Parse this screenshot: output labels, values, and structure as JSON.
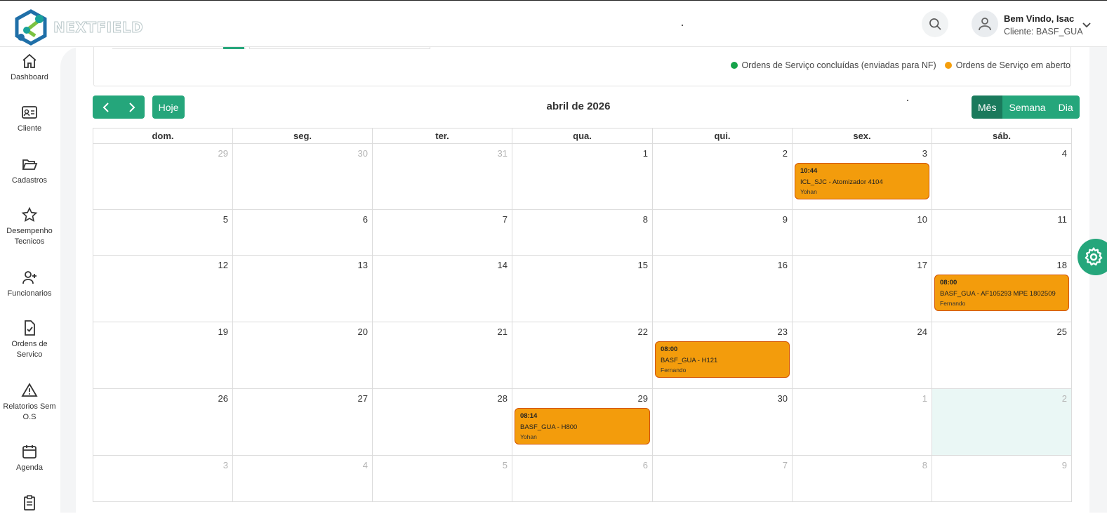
{
  "brand": {
    "name": "NEXTFIELD"
  },
  "user": {
    "welcome": "Bem Vindo, Isac",
    "client": "Cliente: BASF_GUA"
  },
  "sidebar": {
    "items": [
      {
        "label": "Dashboard",
        "icon": "home-icon"
      },
      {
        "label": "Cliente",
        "icon": "id-card-icon"
      },
      {
        "label": "Cadastros",
        "icon": "folder-open-icon"
      },
      {
        "label": "Desempenho Tecnicos",
        "icon": "star-icon"
      },
      {
        "label": "Funcionarios",
        "icon": "user-plus-icon"
      },
      {
        "label": "Ordens de Servico",
        "icon": "file-check-icon"
      },
      {
        "label": "Relatorios Sem O.S",
        "icon": "alert-triangle-icon"
      },
      {
        "label": "Agenda",
        "icon": "calendar-icon"
      },
      {
        "label": "",
        "icon": "clipboard-list-icon"
      }
    ]
  },
  "legend": {
    "done_label": "Ordens de Serviço concluídas (enviadas para NF)",
    "open_label": "Ordens de Serviço em aberto",
    "done_color": "#16a34a",
    "open_color": "#f59e0b"
  },
  "toolbar": {
    "prev_label": "‹",
    "next_label": "›",
    "today_label": "Hoje",
    "title": "abril de 2026",
    "views": [
      {
        "label": "Mês",
        "active": true
      },
      {
        "label": "Semana",
        "active": false
      },
      {
        "label": "Dia",
        "active": false
      }
    ]
  },
  "calendar": {
    "weekdays": [
      "dom.",
      "seg.",
      "ter.",
      "qua.",
      "qui.",
      "sex.",
      "sáb."
    ],
    "weeks": [
      {
        "days": [
          {
            "n": "29",
            "other": true
          },
          {
            "n": "30",
            "other": true
          },
          {
            "n": "31",
            "other": true
          },
          {
            "n": "1"
          },
          {
            "n": "2"
          },
          {
            "n": "3",
            "event": {
              "time": "10:44",
              "title": "ICL_SJC - Atomizador 4104",
              "tech": "Yohan"
            }
          },
          {
            "n": "4"
          }
        ]
      },
      {
        "days": [
          {
            "n": "5"
          },
          {
            "n": "6"
          },
          {
            "n": "7"
          },
          {
            "n": "8"
          },
          {
            "n": "9"
          },
          {
            "n": "10"
          },
          {
            "n": "11"
          }
        ]
      },
      {
        "days": [
          {
            "n": "12"
          },
          {
            "n": "13"
          },
          {
            "n": "14"
          },
          {
            "n": "15"
          },
          {
            "n": "16"
          },
          {
            "n": "17"
          },
          {
            "n": "18",
            "event": {
              "time": "08:00",
              "title": "BASF_GUA - AF105293 MPE 1802509",
              "tech": "Fernando"
            }
          }
        ]
      },
      {
        "days": [
          {
            "n": "19"
          },
          {
            "n": "20"
          },
          {
            "n": "21"
          },
          {
            "n": "22"
          },
          {
            "n": "23",
            "event": {
              "time": "08:00",
              "title": "BASF_GUA - H121",
              "tech": "Fernando"
            }
          },
          {
            "n": "24"
          },
          {
            "n": "25"
          }
        ]
      },
      {
        "days": [
          {
            "n": "26"
          },
          {
            "n": "27"
          },
          {
            "n": "28"
          },
          {
            "n": "29",
            "event": {
              "time": "08:14",
              "title": "BASF_GUA - H800",
              "tech": "Yohan"
            }
          },
          {
            "n": "30"
          },
          {
            "n": "1",
            "other": true
          },
          {
            "n": "2",
            "other": true,
            "highlight": true
          }
        ]
      },
      {
        "days": [
          {
            "n": "3",
            "other": true
          },
          {
            "n": "4",
            "other": true
          },
          {
            "n": "5",
            "other": true
          },
          {
            "n": "6",
            "other": true
          },
          {
            "n": "7",
            "other": true
          },
          {
            "n": "8",
            "other": true
          },
          {
            "n": "9",
            "other": true
          }
        ]
      }
    ]
  }
}
